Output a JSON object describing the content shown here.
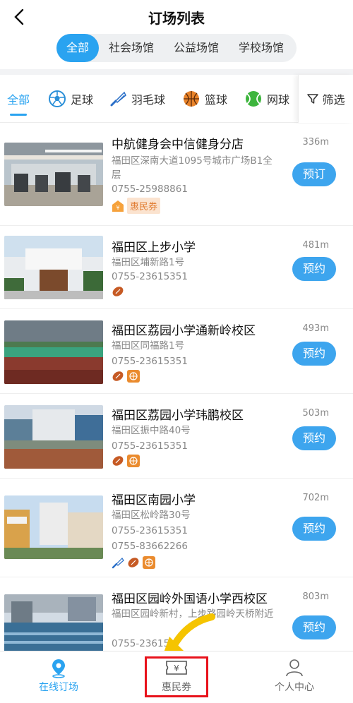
{
  "header": {
    "title": "订场列表"
  },
  "venue_types": [
    "全部",
    "社会场馆",
    "公益场馆",
    "学校场馆"
  ],
  "sports": [
    {
      "label": "全部",
      "icon": ""
    },
    {
      "label": "足球",
      "icon": "soccer-icon"
    },
    {
      "label": "羽毛球",
      "icon": "badminton-icon"
    },
    {
      "label": "篮球",
      "icon": "basketball-icon"
    },
    {
      "label": "网球",
      "icon": "tennis-icon"
    }
  ],
  "filter_label": "筛选",
  "venues": [
    {
      "name": "中航健身会中信健身分店",
      "address": "福田区深南大道1095号城市广场B1全层",
      "phones": [
        "0755-25988861"
      ],
      "distance": "336m",
      "button": "预订",
      "coupon": "惠民券",
      "thumb": "gym-photo"
    },
    {
      "name": "福田区上步小学",
      "address": "福田区埔新路1号",
      "phones": [
        "0755-23615351"
      ],
      "distance": "481m",
      "button": "预约",
      "thumb": "school-gate-photo"
    },
    {
      "name": "福田区荔园小学通新岭校区",
      "address": "福田区同福路1号",
      "phones": [
        "0755-23615351"
      ],
      "distance": "493m",
      "button": "预约",
      "thumb": "green-court-photo"
    },
    {
      "name": "福田区荔园小学玮鹏校区",
      "address": "福田区振中路40号",
      "phones": [
        "0755-23615351"
      ],
      "distance": "503m",
      "button": "预约",
      "thumb": "school-yard-photo"
    },
    {
      "name": "福田区南园小学",
      "address": "福田区松岭路30号",
      "phones": [
        "0755-23615351",
        "0755-83662266"
      ],
      "distance": "702m",
      "button": "预约",
      "thumb": "school-building-photo"
    },
    {
      "name": "福田区园岭外国语小学西校区",
      "address": "福田区园岭新村，上步路园岭天桥附近",
      "phones": [
        "0755-23615"
      ],
      "distance": "803m",
      "button": "预约",
      "thumb": "pool-photo"
    }
  ],
  "bottom_nav": [
    {
      "label": "在线订场",
      "icon": "location-pin-icon"
    },
    {
      "label": "惠民券",
      "icon": "coupon-icon"
    },
    {
      "label": "个人中心",
      "icon": "user-icon"
    }
  ],
  "colors": {
    "accent": "#2aa3f0",
    "highlight": "#e8121b",
    "coupon_bg": "#fbe3cf",
    "coupon_text": "#e07a2e"
  }
}
